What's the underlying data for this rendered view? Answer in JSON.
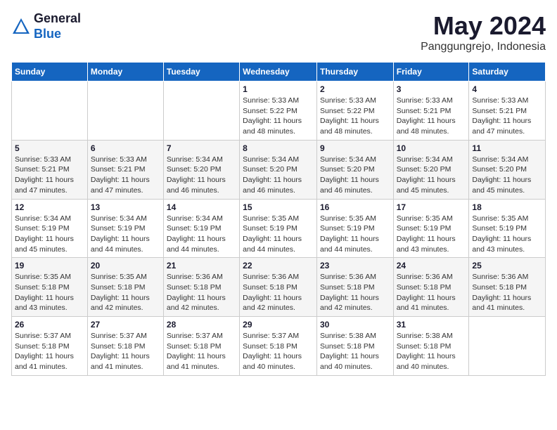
{
  "logo": {
    "general": "General",
    "blue": "Blue"
  },
  "title": {
    "month_year": "May 2024",
    "location": "Panggungrejo, Indonesia"
  },
  "days_of_week": [
    "Sunday",
    "Monday",
    "Tuesday",
    "Wednesday",
    "Thursday",
    "Friday",
    "Saturday"
  ],
  "weeks": [
    [
      {
        "day": "",
        "info": ""
      },
      {
        "day": "",
        "info": ""
      },
      {
        "day": "",
        "info": ""
      },
      {
        "day": "1",
        "info": "Sunrise: 5:33 AM\nSunset: 5:22 PM\nDaylight: 11 hours and 48 minutes."
      },
      {
        "day": "2",
        "info": "Sunrise: 5:33 AM\nSunset: 5:22 PM\nDaylight: 11 hours and 48 minutes."
      },
      {
        "day": "3",
        "info": "Sunrise: 5:33 AM\nSunset: 5:21 PM\nDaylight: 11 hours and 48 minutes."
      },
      {
        "day": "4",
        "info": "Sunrise: 5:33 AM\nSunset: 5:21 PM\nDaylight: 11 hours and 47 minutes."
      }
    ],
    [
      {
        "day": "5",
        "info": "Sunrise: 5:33 AM\nSunset: 5:21 PM\nDaylight: 11 hours and 47 minutes."
      },
      {
        "day": "6",
        "info": "Sunrise: 5:33 AM\nSunset: 5:21 PM\nDaylight: 11 hours and 47 minutes."
      },
      {
        "day": "7",
        "info": "Sunrise: 5:34 AM\nSunset: 5:20 PM\nDaylight: 11 hours and 46 minutes."
      },
      {
        "day": "8",
        "info": "Sunrise: 5:34 AM\nSunset: 5:20 PM\nDaylight: 11 hours and 46 minutes."
      },
      {
        "day": "9",
        "info": "Sunrise: 5:34 AM\nSunset: 5:20 PM\nDaylight: 11 hours and 46 minutes."
      },
      {
        "day": "10",
        "info": "Sunrise: 5:34 AM\nSunset: 5:20 PM\nDaylight: 11 hours and 45 minutes."
      },
      {
        "day": "11",
        "info": "Sunrise: 5:34 AM\nSunset: 5:20 PM\nDaylight: 11 hours and 45 minutes."
      }
    ],
    [
      {
        "day": "12",
        "info": "Sunrise: 5:34 AM\nSunset: 5:19 PM\nDaylight: 11 hours and 45 minutes."
      },
      {
        "day": "13",
        "info": "Sunrise: 5:34 AM\nSunset: 5:19 PM\nDaylight: 11 hours and 44 minutes."
      },
      {
        "day": "14",
        "info": "Sunrise: 5:34 AM\nSunset: 5:19 PM\nDaylight: 11 hours and 44 minutes."
      },
      {
        "day": "15",
        "info": "Sunrise: 5:35 AM\nSunset: 5:19 PM\nDaylight: 11 hours and 44 minutes."
      },
      {
        "day": "16",
        "info": "Sunrise: 5:35 AM\nSunset: 5:19 PM\nDaylight: 11 hours and 44 minutes."
      },
      {
        "day": "17",
        "info": "Sunrise: 5:35 AM\nSunset: 5:19 PM\nDaylight: 11 hours and 43 minutes."
      },
      {
        "day": "18",
        "info": "Sunrise: 5:35 AM\nSunset: 5:19 PM\nDaylight: 11 hours and 43 minutes."
      }
    ],
    [
      {
        "day": "19",
        "info": "Sunrise: 5:35 AM\nSunset: 5:18 PM\nDaylight: 11 hours and 43 minutes."
      },
      {
        "day": "20",
        "info": "Sunrise: 5:35 AM\nSunset: 5:18 PM\nDaylight: 11 hours and 42 minutes."
      },
      {
        "day": "21",
        "info": "Sunrise: 5:36 AM\nSunset: 5:18 PM\nDaylight: 11 hours and 42 minutes."
      },
      {
        "day": "22",
        "info": "Sunrise: 5:36 AM\nSunset: 5:18 PM\nDaylight: 11 hours and 42 minutes."
      },
      {
        "day": "23",
        "info": "Sunrise: 5:36 AM\nSunset: 5:18 PM\nDaylight: 11 hours and 42 minutes."
      },
      {
        "day": "24",
        "info": "Sunrise: 5:36 AM\nSunset: 5:18 PM\nDaylight: 11 hours and 41 minutes."
      },
      {
        "day": "25",
        "info": "Sunrise: 5:36 AM\nSunset: 5:18 PM\nDaylight: 11 hours and 41 minutes."
      }
    ],
    [
      {
        "day": "26",
        "info": "Sunrise: 5:37 AM\nSunset: 5:18 PM\nDaylight: 11 hours and 41 minutes."
      },
      {
        "day": "27",
        "info": "Sunrise: 5:37 AM\nSunset: 5:18 PM\nDaylight: 11 hours and 41 minutes."
      },
      {
        "day": "28",
        "info": "Sunrise: 5:37 AM\nSunset: 5:18 PM\nDaylight: 11 hours and 41 minutes."
      },
      {
        "day": "29",
        "info": "Sunrise: 5:37 AM\nSunset: 5:18 PM\nDaylight: 11 hours and 40 minutes."
      },
      {
        "day": "30",
        "info": "Sunrise: 5:38 AM\nSunset: 5:18 PM\nDaylight: 11 hours and 40 minutes."
      },
      {
        "day": "31",
        "info": "Sunrise: 5:38 AM\nSunset: 5:18 PM\nDaylight: 11 hours and 40 minutes."
      },
      {
        "day": "",
        "info": ""
      }
    ]
  ]
}
